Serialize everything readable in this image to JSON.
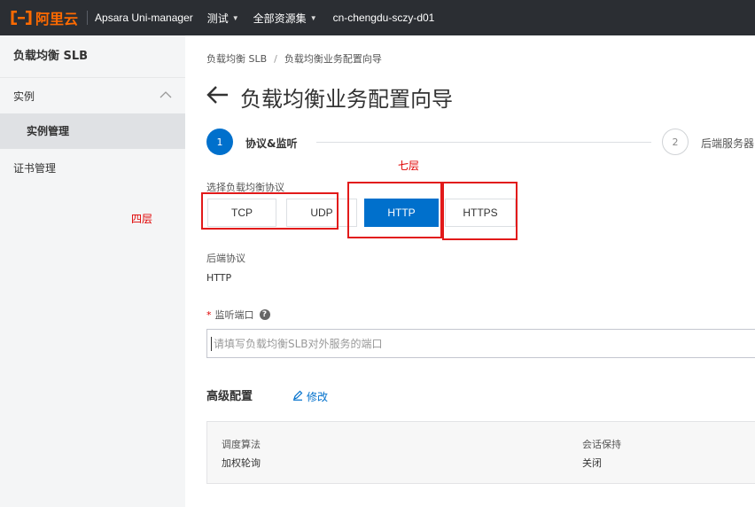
{
  "topbar": {
    "logo_text": "阿里云",
    "product": "Apsara Uni-manager",
    "nav_test": "测试",
    "nav_resources": "全部资源集",
    "region": "cn-chengdu-sczy-d01"
  },
  "sidebar": {
    "title": "负载均衡 SLB",
    "group": "实例",
    "sub_item": "实例管理",
    "item": "证书管理"
  },
  "breadcrumb": {
    "parent": "负载均衡 SLB",
    "separator": "/",
    "current": "负载均衡业务配置向导"
  },
  "page": {
    "title": "负载均衡业务配置向导"
  },
  "steps": [
    {
      "number": "1",
      "label": "协议&监听"
    },
    {
      "number": "2",
      "label": "后端服务器"
    }
  ],
  "annotations": {
    "layer7": "七层",
    "layer4": "四层"
  },
  "protocol": {
    "label": "选择负载均衡协议",
    "options": [
      "TCP",
      "UDP",
      "HTTP",
      "HTTPS"
    ],
    "selected": "HTTP"
  },
  "backend": {
    "label": "后端协议",
    "value": "HTTP"
  },
  "port": {
    "required_mark": "*",
    "label": "监听端口",
    "help": "?",
    "placeholder": "请填写负载均衡SLB对外服务的端口",
    "value": ""
  },
  "advanced": {
    "title": "高级配置",
    "edit_label": "修改",
    "items": [
      {
        "key": "调度算法",
        "value": "加权轮询"
      },
      {
        "key": "会话保持",
        "value": "关闭"
      }
    ]
  },
  "colors": {
    "primary": "#0070cc",
    "brand": "#ff6a00",
    "annotation": "#e21a1a",
    "topbar": "#2b2e33"
  }
}
